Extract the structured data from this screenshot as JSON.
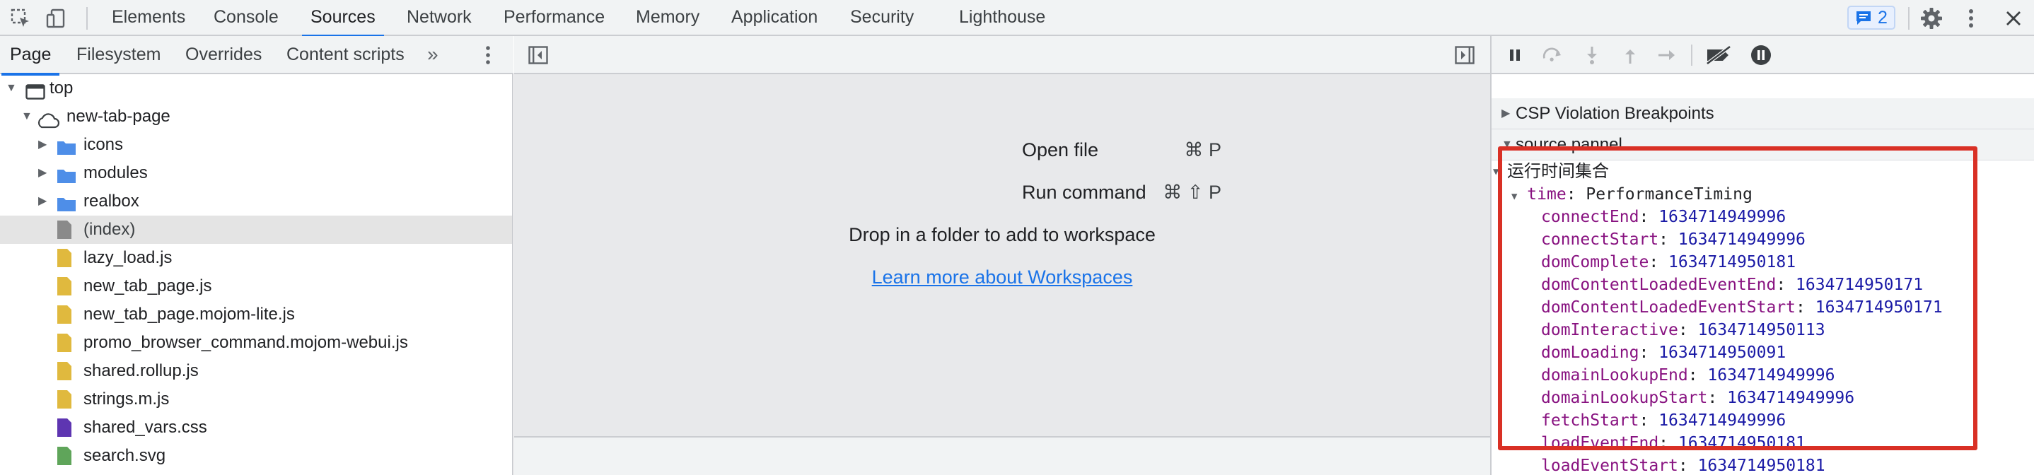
{
  "topbar": {
    "tabs": [
      "Elements",
      "Console",
      "Sources",
      "Network",
      "Performance",
      "Memory",
      "Application",
      "Security",
      "Lighthouse"
    ],
    "active_tab": "Sources",
    "issues_count": "2"
  },
  "navigator": {
    "tabs": [
      "Page",
      "Filesystem",
      "Overrides",
      "Content scripts"
    ],
    "active_tab": "Page",
    "tree": [
      {
        "label": "top",
        "type": "frame",
        "expanded": true
      },
      {
        "label": "new-tab-page",
        "type": "cloud",
        "expanded": true
      },
      {
        "label": "icons",
        "type": "folder",
        "expanded": false
      },
      {
        "label": "modules",
        "type": "folder",
        "expanded": false
      },
      {
        "label": "realbox",
        "type": "folder",
        "expanded": false
      },
      {
        "label": "(index)",
        "type": "document",
        "selected": true
      },
      {
        "label": "lazy_load.js",
        "type": "js"
      },
      {
        "label": "new_tab_page.js",
        "type": "js"
      },
      {
        "label": "new_tab_page.mojom-lite.js",
        "type": "js"
      },
      {
        "label": "promo_browser_command.mojom-webui.js",
        "type": "js"
      },
      {
        "label": "shared.rollup.js",
        "type": "js"
      },
      {
        "label": "strings.m.js",
        "type": "js"
      },
      {
        "label": "shared_vars.css",
        "type": "css"
      },
      {
        "label": "search.svg",
        "type": "svg"
      }
    ]
  },
  "editor": {
    "shortcut_open_key": "⌘ P",
    "shortcut_open_label": "Open file",
    "shortcut_run_key": "⌘ ⇧ P",
    "shortcut_run_label": "Run command",
    "drop_text": "Drop in a folder to add to workspace",
    "learn_link": "Learn more about Workspaces"
  },
  "debugger": {
    "sections": [
      {
        "label": "CSP Violation Breakpoints",
        "expanded": false
      },
      {
        "label": "source pannel",
        "expanded": true
      }
    ],
    "scope_group": "运行时间集合",
    "time_name": "time",
    "time_type": "PerformanceTiming",
    "props": [
      {
        "name": "connectEnd",
        "value": "1634714949996"
      },
      {
        "name": "connectStart",
        "value": "1634714949996"
      },
      {
        "name": "domComplete",
        "value": "1634714950181"
      },
      {
        "name": "domContentLoadedEventEnd",
        "value": "1634714950171"
      },
      {
        "name": "domContentLoadedEventStart",
        "value": "1634714950171"
      },
      {
        "name": "domInteractive",
        "value": "1634714950113"
      },
      {
        "name": "domLoading",
        "value": "1634714950091"
      },
      {
        "name": "domainLookupEnd",
        "value": "1634714949996"
      },
      {
        "name": "domainLookupStart",
        "value": "1634714949996"
      },
      {
        "name": "fetchStart",
        "value": "1634714949996"
      },
      {
        "name": "loadEventEnd",
        "value": "1634714950181"
      },
      {
        "name": "loadEventStart",
        "value": "1634714950181"
      }
    ]
  },
  "colors": {
    "accent": "#1a73e8",
    "highlight": "#d93025",
    "folder": "#4e8ee8",
    "js_file": "#e0b93e",
    "css_file": "#5e35b1",
    "svg_file": "#5fa55a"
  }
}
